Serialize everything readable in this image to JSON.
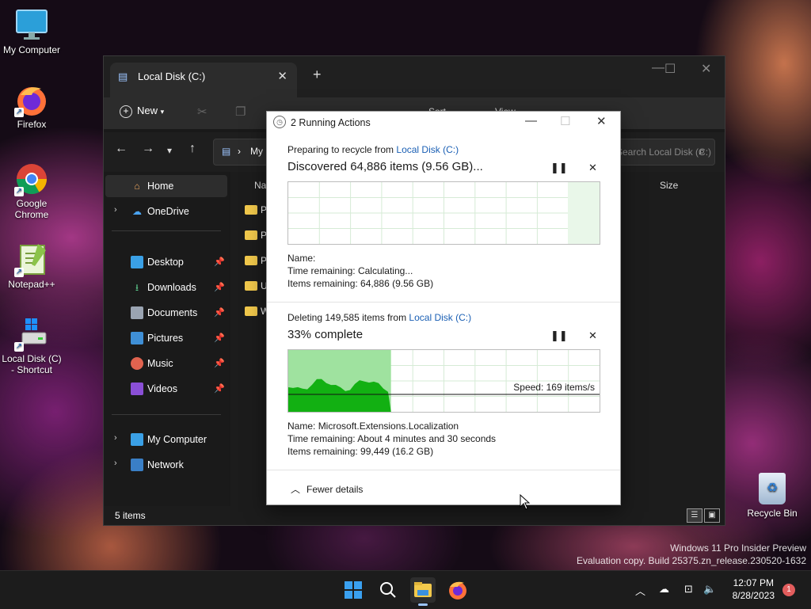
{
  "desktop": {
    "icons": [
      {
        "label": "My Computer"
      },
      {
        "label": "Firefox"
      },
      {
        "label": "Google Chrome"
      },
      {
        "label": "Notepad++"
      },
      {
        "label": "Local Disk (C) - Shortcut"
      }
    ],
    "recycle_bin": "Recycle Bin",
    "watermark_line1": "Windows 11 Pro Insider Preview",
    "watermark_line2": "Evaluation copy. Build 25375.zn_release.230520-1632"
  },
  "explorer": {
    "tab_title": "Local Disk (C:)",
    "toolbar": {
      "new_label": "New",
      "sort_label": "Sort",
      "view_label": "View"
    },
    "address_partial": "My C",
    "search_placeholder": "Search Local Disk (C:)",
    "columns": {
      "name": "Name",
      "size": "Size"
    },
    "sidebar": {
      "home": "Home",
      "onedrive": "OneDrive",
      "pinned": [
        "Desktop",
        "Downloads",
        "Documents",
        "Pictures",
        "Music",
        "Videos"
      ],
      "my_computer": "My Computer",
      "network": "Network"
    },
    "files": [
      "P",
      "P",
      "P",
      "U",
      "W"
    ],
    "status_items": "5 items"
  },
  "dialog": {
    "title": "2 Running Actions",
    "op1": {
      "line": "Preparing to recycle from",
      "source": "Local Disk (C:)",
      "headline": "Discovered 64,886 items (9.56 GB)...",
      "name_label": "Name:",
      "name_value": "",
      "time_label": "Time remaining:",
      "time_value": "Calculating...",
      "items_label": "Items remaining:",
      "items_value": "64,886 (9.56 GB)"
    },
    "op2": {
      "line": "Deleting 149,585 items from",
      "source": "Local Disk (C:)",
      "headline": "33% complete",
      "progress": 0.33,
      "speed": "Speed: 169 items/s",
      "name_label": "Name:",
      "name_value": "Microsoft.Extensions.Localization",
      "time_label": "Time remaining:",
      "time_value": "About 4 minutes and 30 seconds",
      "items_label": "Items remaining:",
      "items_value": "99,449 (16.2 GB)"
    },
    "fewer_details": "Fewer details"
  },
  "taskbar": {
    "time": "12:07 PM",
    "date": "8/28/2023",
    "notification_count": "1"
  }
}
